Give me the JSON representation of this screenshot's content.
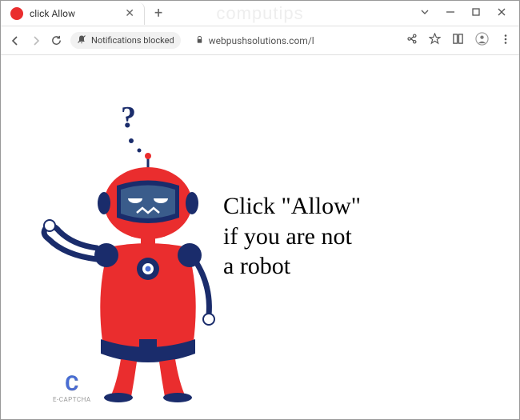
{
  "tab": {
    "title": "click Allow"
  },
  "toolbar": {
    "notif_blocked": "Notifications blocked",
    "url": "webpushsolutions.com/l"
  },
  "page": {
    "message_line1": "Click \"Allow\"",
    "message_line2": "if you are not",
    "message_line3": "a robot",
    "captcha_label": "E-CAPTCHA",
    "captcha_letter": "C",
    "question_mark": "?"
  },
  "watermark": "computips"
}
